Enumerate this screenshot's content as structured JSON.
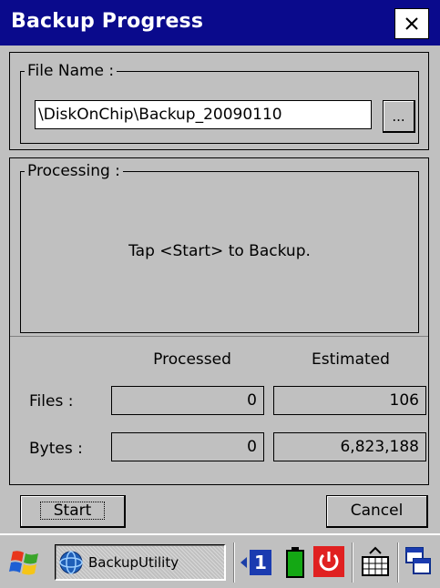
{
  "window": {
    "title": "Backup Progress",
    "close_label": "×"
  },
  "file_group": {
    "label": "File Name :",
    "path": "\\DiskOnChip\\Backup_20090110",
    "browse_label": "..."
  },
  "processing": {
    "label": "Processing :",
    "message": "Tap <Start> to Backup.",
    "col_processed": "Processed",
    "col_estimated": "Estimated",
    "rows": [
      {
        "label": "Files :",
        "processed": "0",
        "estimated": "106"
      },
      {
        "label": "Bytes :",
        "processed": "0",
        "estimated": "6,823,188"
      }
    ]
  },
  "buttons": {
    "start": "Start",
    "cancel": "Cancel"
  },
  "taskbar": {
    "task_label": "BackupUtility",
    "input_number": "1",
    "icons": [
      "windows-start-icon",
      "app-globe-icon",
      "input-arrow-icon",
      "battery-icon",
      "power-icon",
      "keyboard-icon",
      "window-switch-icon"
    ]
  },
  "colors": {
    "title_bar": "#0a0a8c",
    "window_bg": "#c0c0c0",
    "battery": "#14a814",
    "power": "#e02020"
  }
}
